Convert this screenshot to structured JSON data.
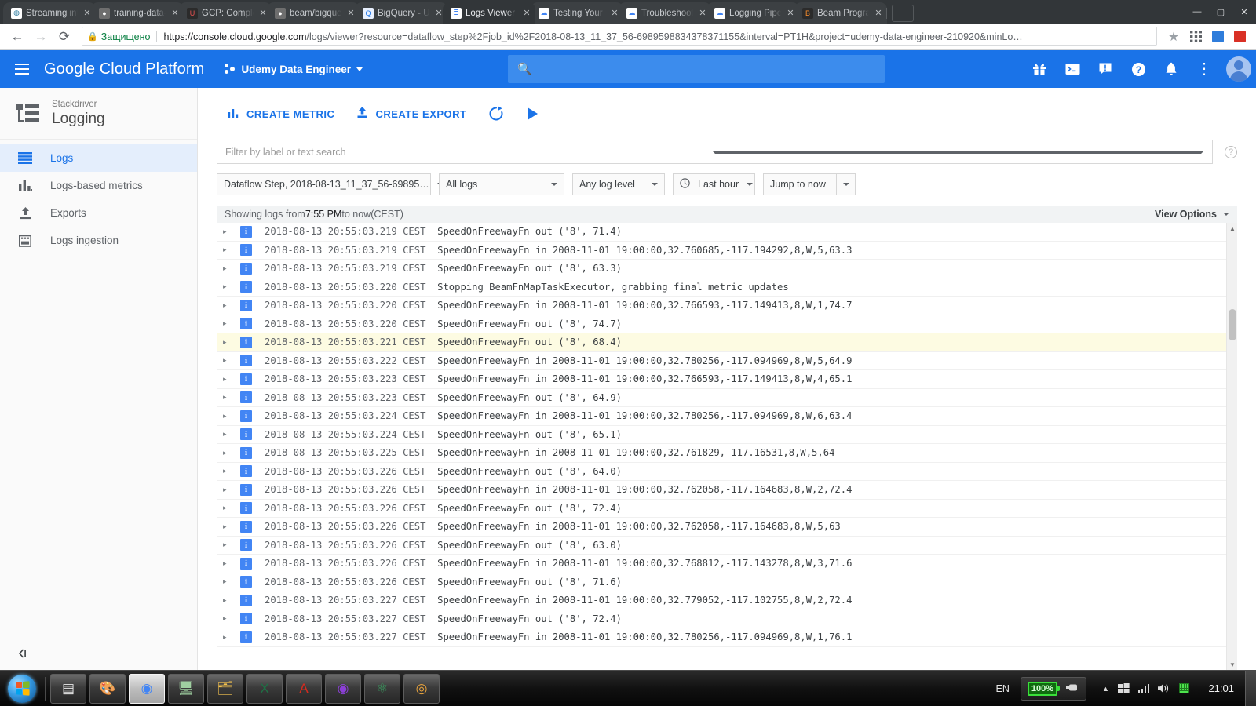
{
  "browser": {
    "tabs": [
      {
        "title": "Streaming into",
        "favicon": "wordpress-icon",
        "fav_bg": "#ffffff",
        "fav_fg": "#21759b",
        "glyph": "◍",
        "active": false
      },
      {
        "title": "training-data-a",
        "favicon": "github-icon",
        "fav_bg": "#6e6e6e",
        "fav_fg": "#ffffff",
        "glyph": "●",
        "active": false
      },
      {
        "title": "GCP: Complete",
        "favicon": "udemy-icon",
        "fav_bg": "#2b2b2b",
        "fav_fg": "#ec5252",
        "glyph": "U",
        "active": false
      },
      {
        "title": "beam/bigquery",
        "favicon": "github-icon",
        "fav_bg": "#6e6e6e",
        "fav_fg": "#ffffff",
        "glyph": "●",
        "active": false
      },
      {
        "title": "BigQuery - Ude",
        "favicon": "bigquery-icon",
        "fav_bg": "#e8f0fe",
        "fav_fg": "#1a73e8",
        "glyph": "Q",
        "active": false
      },
      {
        "title": "Logs Viewer - L",
        "favicon": "stackdriver-logging-icon",
        "fav_bg": "#ffffff",
        "fav_fg": "#4285f4",
        "glyph": "≣",
        "active": true
      },
      {
        "title": "Testing Your Pi",
        "favicon": "google-cloud-icon",
        "fav_bg": "#ffffff",
        "fav_fg": "#4285f4",
        "glyph": "☁",
        "active": false
      },
      {
        "title": "Troubleshootin",
        "favicon": "google-cloud-icon",
        "fav_bg": "#ffffff",
        "fav_fg": "#4285f4",
        "glyph": "☁",
        "active": false
      },
      {
        "title": "Logging Pipelin",
        "favicon": "google-cloud-icon",
        "fav_bg": "#ffffff",
        "fav_fg": "#4285f4",
        "glyph": "☁",
        "active": false
      },
      {
        "title": "Beam Programm",
        "favicon": "beam-icon",
        "fav_bg": "#2b2b2b",
        "fav_fg": "#ff8f2b",
        "glyph": "B",
        "active": false
      }
    ],
    "tab_close_label": "✕",
    "new_tab_label": "",
    "window_controls": {
      "minimize": "—",
      "maximize": "▢",
      "close": "✕"
    },
    "nav": {
      "back": "←",
      "forward": "→",
      "reload": "⟳"
    },
    "security_label": "Защищено",
    "lock_icon": "lock-icon",
    "url_host": "https://console.cloud.google.com",
    "url_path": "/logs/viewer?resource=dataflow_step%2Fjob_id%2F2018-08-13_11_37_56-6989598834378371155&interval=PT1H&project=udemy-data-engineer-210920&minLo…",
    "star_icon": "★",
    "toolbar_icons": [
      "apps-grid-icon",
      "extension-blue-icon",
      "extension-red-icon"
    ]
  },
  "gcp_header": {
    "menu_icon": "hamburger-menu-icon",
    "brand": "Google Cloud Platform",
    "project_name": "Udemy Data Engineer",
    "search_placeholder": "",
    "search_value": "",
    "icons": [
      {
        "name": "gift-icon",
        "glyph": "🎁"
      },
      {
        "name": "cloud-shell-icon",
        "glyph": ">_"
      },
      {
        "name": "feedback-icon",
        "glyph": "!"
      },
      {
        "name": "help-icon",
        "glyph": "?"
      },
      {
        "name": "notifications-bell-icon",
        "glyph": "🔔"
      },
      {
        "name": "more-vert-icon",
        "glyph": "⋮"
      }
    ],
    "avatar": "user-avatar"
  },
  "sidebar": {
    "product_sub": "Stackdriver",
    "product_title": "Logging",
    "items": [
      {
        "label": "Logs",
        "icon": "logs-icon",
        "active": true
      },
      {
        "label": "Logs-based metrics",
        "icon": "bar-chart-icon",
        "active": false
      },
      {
        "label": "Exports",
        "icon": "upload-icon",
        "active": false
      },
      {
        "label": "Logs ingestion",
        "icon": "calendar-icon",
        "active": false
      }
    ],
    "collapse_label": "◁|"
  },
  "toolbar": {
    "create_metric_label": "CREATE METRIC",
    "create_metric_icon": "bar-chart-icon",
    "create_export_label": "CREATE EXPORT",
    "create_export_icon": "upload-icon",
    "refresh_icon": "refresh-icon",
    "play_icon": "play-icon"
  },
  "filters": {
    "search_placeholder": "Filter by label or text search",
    "search_value": "",
    "help_icon": "help-circle-icon",
    "resource": "Dataflow Step, 2018-08-13_11_37_56-69895…",
    "logs": "All logs",
    "level": "Any log level",
    "time_range": "Last hour",
    "time_icon": "clock-icon",
    "jump": "Jump to now"
  },
  "status_bar": {
    "prefix": "Showing logs from ",
    "time": "7:55 PM",
    "middle": " to now ",
    "suffix": "(CEST)",
    "view_options": "View Options"
  },
  "log_entries": [
    {
      "severity": "i",
      "timestamp": "2018-08-13 20:55:03.219 CEST",
      "message": "SpeedOnFreewayFn out ('8', 71.4)",
      "highlighted": false
    },
    {
      "severity": "i",
      "timestamp": "2018-08-13 20:55:03.219 CEST",
      "message": "SpeedOnFreewayFn in 2008-11-01 19:00:00,32.760685,-117.194292,8,W,5,63.3",
      "highlighted": false
    },
    {
      "severity": "i",
      "timestamp": "2018-08-13 20:55:03.219 CEST",
      "message": "SpeedOnFreewayFn out ('8', 63.3)",
      "highlighted": false
    },
    {
      "severity": "i",
      "timestamp": "2018-08-13 20:55:03.220 CEST",
      "message": "Stopping BeamFnMapTaskExecutor, grabbing final metric updates",
      "highlighted": false
    },
    {
      "severity": "i",
      "timestamp": "2018-08-13 20:55:03.220 CEST",
      "message": "SpeedOnFreewayFn in 2008-11-01 19:00:00,32.766593,-117.149413,8,W,1,74.7",
      "highlighted": false
    },
    {
      "severity": "i",
      "timestamp": "2018-08-13 20:55:03.220 CEST",
      "message": "SpeedOnFreewayFn out ('8', 74.7)",
      "highlighted": false
    },
    {
      "severity": "i",
      "timestamp": "2018-08-13 20:55:03.221 CEST",
      "message": "SpeedOnFreewayFn out ('8', 68.4)",
      "highlighted": true
    },
    {
      "severity": "i",
      "timestamp": "2018-08-13 20:55:03.222 CEST",
      "message": "SpeedOnFreewayFn in 2008-11-01 19:00:00,32.780256,-117.094969,8,W,5,64.9",
      "highlighted": false
    },
    {
      "severity": "i",
      "timestamp": "2018-08-13 20:55:03.223 CEST",
      "message": "SpeedOnFreewayFn in 2008-11-01 19:00:00,32.766593,-117.149413,8,W,4,65.1",
      "highlighted": false
    },
    {
      "severity": "i",
      "timestamp": "2018-08-13 20:55:03.223 CEST",
      "message": "SpeedOnFreewayFn out ('8', 64.9)",
      "highlighted": false
    },
    {
      "severity": "i",
      "timestamp": "2018-08-13 20:55:03.224 CEST",
      "message": "SpeedOnFreewayFn in 2008-11-01 19:00:00,32.780256,-117.094969,8,W,6,63.4",
      "highlighted": false
    },
    {
      "severity": "i",
      "timestamp": "2018-08-13 20:55:03.224 CEST",
      "message": "SpeedOnFreewayFn out ('8', 65.1)",
      "highlighted": false
    },
    {
      "severity": "i",
      "timestamp": "2018-08-13 20:55:03.225 CEST",
      "message": "SpeedOnFreewayFn in 2008-11-01 19:00:00,32.761829,-117.16531,8,W,5,64",
      "highlighted": false
    },
    {
      "severity": "i",
      "timestamp": "2018-08-13 20:55:03.226 CEST",
      "message": "SpeedOnFreewayFn out ('8', 64.0)",
      "highlighted": false
    },
    {
      "severity": "i",
      "timestamp": "2018-08-13 20:55:03.226 CEST",
      "message": "SpeedOnFreewayFn in 2008-11-01 19:00:00,32.762058,-117.164683,8,W,2,72.4",
      "highlighted": false
    },
    {
      "severity": "i",
      "timestamp": "2018-08-13 20:55:03.226 CEST",
      "message": "SpeedOnFreewayFn out ('8', 72.4)",
      "highlighted": false
    },
    {
      "severity": "i",
      "timestamp": "2018-08-13 20:55:03.226 CEST",
      "message": "SpeedOnFreewayFn in 2008-11-01 19:00:00,32.762058,-117.164683,8,W,5,63",
      "highlighted": false
    },
    {
      "severity": "i",
      "timestamp": "2018-08-13 20:55:03.226 CEST",
      "message": "SpeedOnFreewayFn out ('8', 63.0)",
      "highlighted": false
    },
    {
      "severity": "i",
      "timestamp": "2018-08-13 20:55:03.226 CEST",
      "message": "SpeedOnFreewayFn in 2008-11-01 19:00:00,32.768812,-117.143278,8,W,3,71.6",
      "highlighted": false
    },
    {
      "severity": "i",
      "timestamp": "2018-08-13 20:55:03.226 CEST",
      "message": "SpeedOnFreewayFn out ('8', 71.6)",
      "highlighted": false
    },
    {
      "severity": "i",
      "timestamp": "2018-08-13 20:55:03.227 CEST",
      "message": "SpeedOnFreewayFn in 2008-11-01 19:00:00,32.779052,-117.102755,8,W,2,72.4",
      "highlighted": false
    },
    {
      "severity": "i",
      "timestamp": "2018-08-13 20:55:03.227 CEST",
      "message": "SpeedOnFreewayFn out ('8', 72.4)",
      "highlighted": false
    },
    {
      "severity": "i",
      "timestamp": "2018-08-13 20:55:03.227 CEST",
      "message": "SpeedOnFreewayFn in 2008-11-01 19:00:00,32.780256,-117.094969,8,W,1,76.1",
      "highlighted": false
    }
  ],
  "taskbar": {
    "start_label": "Start",
    "items": [
      {
        "name": "notepad-icon",
        "glyph": "▤",
        "color": "#e8e8e8",
        "active": false
      },
      {
        "name": "paint-icon",
        "glyph": "🎨",
        "color": "#f0c24b",
        "active": false
      },
      {
        "name": "chrome-icon",
        "glyph": "◉",
        "color": "#4285f4",
        "active": true
      },
      {
        "name": "monitor-icon",
        "glyph": "🖥",
        "color": "#9fd0a0",
        "active": false
      },
      {
        "name": "file-explorer-icon",
        "glyph": "🗂",
        "color": "#f2c14e",
        "active": false
      },
      {
        "name": "excel-icon",
        "glyph": "X",
        "color": "#1e7145",
        "active": false
      },
      {
        "name": "acrobat-icon",
        "glyph": "A",
        "color": "#d42b1f",
        "active": false
      },
      {
        "name": "media-player-icon",
        "glyph": "◉",
        "color": "#8b3fd6",
        "active": false
      },
      {
        "name": "atom-icon",
        "glyph": "⚛",
        "color": "#3aa563",
        "active": false
      },
      {
        "name": "opera-icon",
        "glyph": "◎",
        "color": "#e8a33d",
        "active": false
      }
    ],
    "language": "EN",
    "battery_percent": "100%",
    "battery_icon": "battery-full-icon",
    "plug_icon": "power-plug-icon",
    "tray_icons": [
      {
        "name": "show-hidden-icons-arrow",
        "glyph": "▲"
      },
      {
        "name": "windows-flag-icon",
        "glyph": "⊞"
      },
      {
        "name": "network-signal-icon",
        "glyph": ""
      },
      {
        "name": "volume-icon",
        "glyph": "🔊"
      },
      {
        "name": "keyboard-layout-icon",
        "glyph": "▦"
      }
    ],
    "clock": "21:01"
  }
}
